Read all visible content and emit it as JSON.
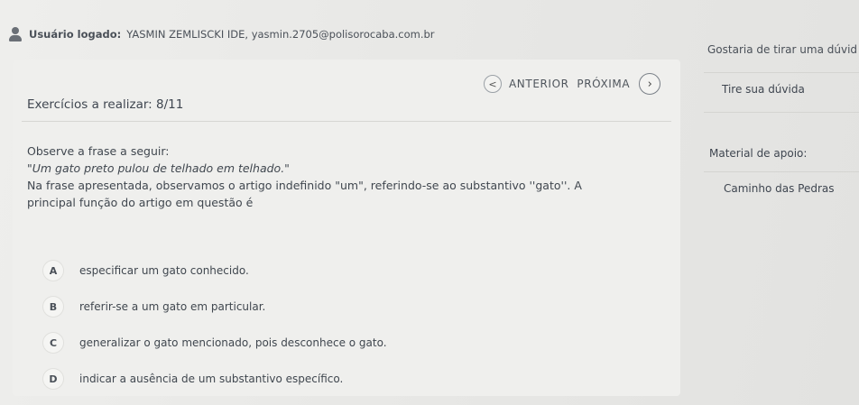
{
  "header": {
    "user_label": "Usuário logado:",
    "user_value": "YASMIN ZEMLISCKI IDE, yasmin.2705@polisorocaba.com.br"
  },
  "exercise": {
    "count_text": "Exercícios a realizar: 8/11"
  },
  "nav": {
    "prev_symbol": "<",
    "text": "ANTERIOR  PRÓXIMA",
    "next_symbol": "›"
  },
  "question": {
    "line1": "Observe a frase a seguir:",
    "line2": "\"Um gato preto pulou de telhado em telhado.\"",
    "line3": "Na frase apresentada, observamos o artigo indefinido \"um\", referindo-se ao substantivo ''gato''. A",
    "line4": "principal função do artigo em questão é"
  },
  "options": [
    {
      "letter": "A",
      "text": "especificar um gato conhecido."
    },
    {
      "letter": "B",
      "text": "referir-se a um gato em particular."
    },
    {
      "letter": "C",
      "text": "generalizar o gato mencionado, pois desconhece o gato."
    },
    {
      "letter": "D",
      "text": "indicar a ausência de um substantivo específico."
    }
  ],
  "sidebar": {
    "title": "Gostaria de tirar uma dúvid",
    "doubt_link": "Tire sua dúvida",
    "material_label": "Material de apoio:",
    "book_link": "Caminho das Pedras"
  }
}
